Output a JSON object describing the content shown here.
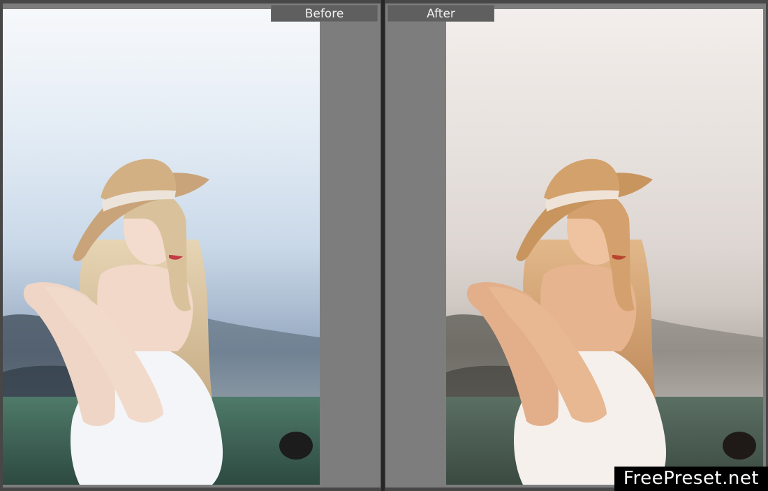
{
  "labels": {
    "before": "Before",
    "after": "After"
  },
  "watermark": "FreePreset.net",
  "palette": {
    "panel_gray": "#7d7d7d",
    "divider": "#262626",
    "label_bg": "#5f5f5f",
    "label_text": "#f1f1f1",
    "before_tone": "cool",
    "after_tone": "warm"
  }
}
